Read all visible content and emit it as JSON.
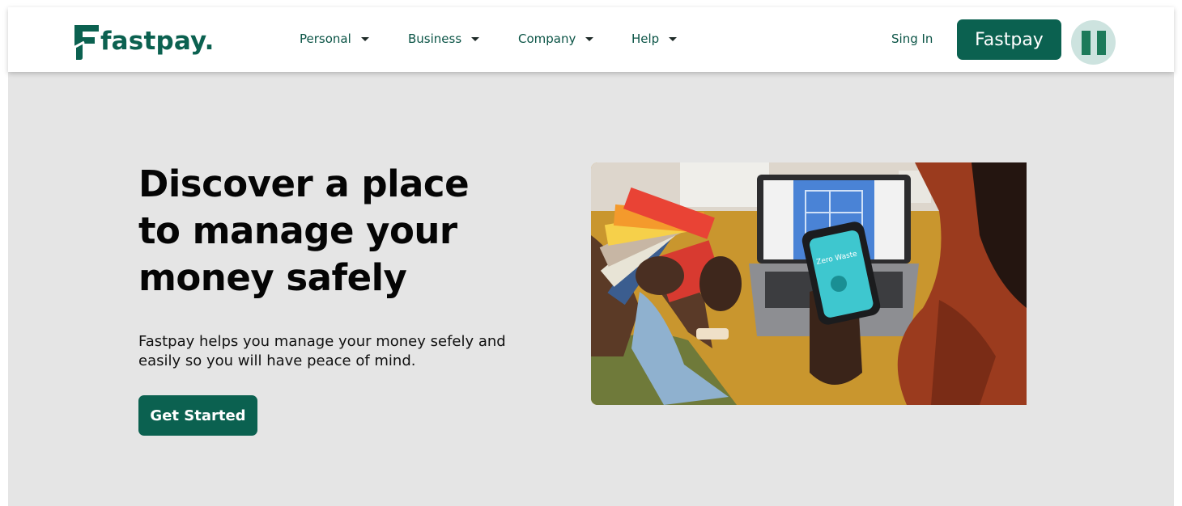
{
  "brand": {
    "name": "fastpay.",
    "color": "#0b6150"
  },
  "nav": {
    "items": [
      {
        "label": "Personal"
      },
      {
        "label": "Business"
      },
      {
        "label": "Company"
      },
      {
        "label": "Help"
      }
    ],
    "signin_label": "Sing In",
    "app_button_label": "Fastpay",
    "language_icon": "nigeria-flag-icon"
  },
  "hero": {
    "title_lines": [
      "Discover a place",
      "to manage your",
      "money safely"
    ],
    "description": "Fastpay helps you manage your money sefely and easily so you  will have peace of mind.",
    "cta_label": "Get Started",
    "image_icon": "hero-photo",
    "image_phone_text": "Zero Waste"
  },
  "colors": {
    "accent": "#0b6150",
    "hero_background": "#e5e5e5",
    "nav_text": "#0b5446"
  }
}
